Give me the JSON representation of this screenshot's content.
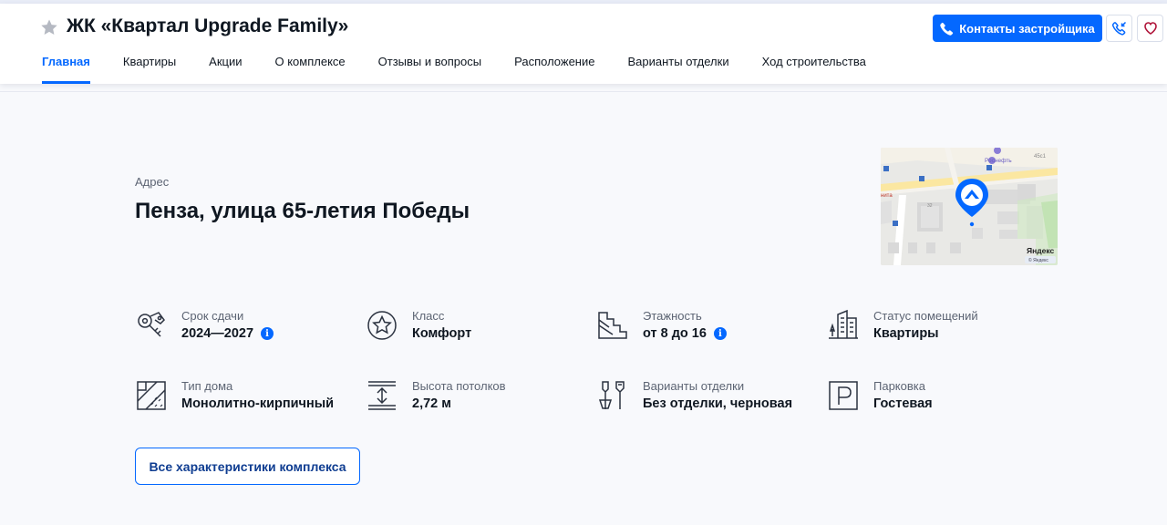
{
  "header": {
    "title": "ЖК «Квартал Upgrade Family»",
    "contacts_button": "Контакты застройщика",
    "favorite_icon": "heart-icon",
    "call_icon": "phone-icon"
  },
  "nav": [
    {
      "label": "Главная",
      "active": true
    },
    {
      "label": "Квартиры",
      "active": false
    },
    {
      "label": "Акции",
      "active": false
    },
    {
      "label": "О комплексе",
      "active": false
    },
    {
      "label": "Отзывы и вопросы",
      "active": false
    },
    {
      "label": "Расположение",
      "active": false
    },
    {
      "label": "Варианты отделки",
      "active": false
    },
    {
      "label": "Ход строительства",
      "active": false
    }
  ],
  "address": {
    "label": "Адрес",
    "value": "Пенза, улица 65-летия Победы"
  },
  "map": {
    "poi_label": "Роснефть",
    "house_number": "45с1",
    "area_label": "нита",
    "building_number": "32",
    "brand": "Яндекс",
    "brand_small": "© Яндекс"
  },
  "features": [
    {
      "label": "Срок сдачи",
      "value": "2024—2027",
      "info": true,
      "icon": "keys-icon"
    },
    {
      "label": "Класс",
      "value": "Комфорт",
      "info": false,
      "icon": "star-circle-icon"
    },
    {
      "label": "Этажность",
      "value": "от 8 до 16",
      "info": true,
      "icon": "stairs-icon"
    },
    {
      "label": "Статус помещений",
      "value": "Квартиры",
      "info": false,
      "icon": "buildings-icon"
    },
    {
      "label": "Тип дома",
      "value": "Монолитно-кирпичный",
      "info": false,
      "icon": "wall-icon"
    },
    {
      "label": "Высота потолков",
      "value": "2,72 м",
      "info": false,
      "icon": "ceiling-height-icon"
    },
    {
      "label": "Варианты отделки",
      "value": "Без отделки, черновая",
      "info": false,
      "icon": "tools-icon"
    },
    {
      "label": "Парковка",
      "value": "Гостевая",
      "info": false,
      "icon": "parking-icon"
    }
  ],
  "all_button": "Все характеристики комплекса",
  "info_glyph": "i",
  "colors": {
    "accent": "#0468ff",
    "text": "#0f1721",
    "muted": "#5c6473"
  }
}
